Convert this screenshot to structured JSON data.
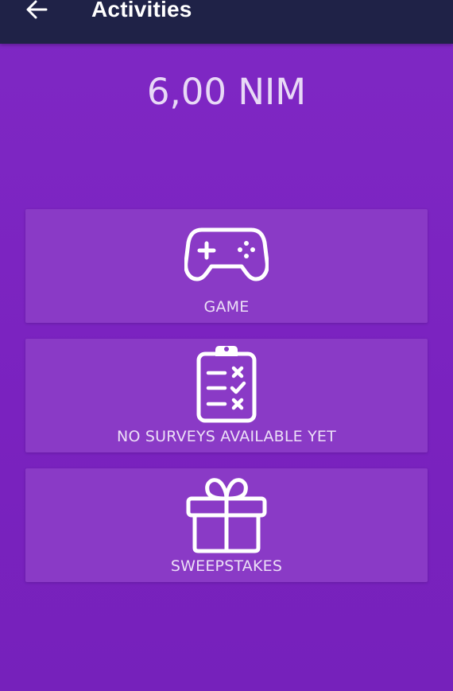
{
  "header": {
    "title": "Activities",
    "back_icon": "arrow-back-icon"
  },
  "balance": {
    "text": "6,00 NIM"
  },
  "activities": [
    {
      "label": "GAME",
      "icon": "gamepad-icon"
    },
    {
      "label": "NO SURVEYS AVAILABLE YET",
      "icon": "clipboard-checklist-icon"
    },
    {
      "label": "SWEEPSTAKES",
      "icon": "gift-icon"
    }
  ],
  "colors": {
    "header_bg": "#1f2247",
    "page_bg": "#7a22bf",
    "card_bg": "#8a3ac6",
    "text_light": "#ecdff7"
  }
}
